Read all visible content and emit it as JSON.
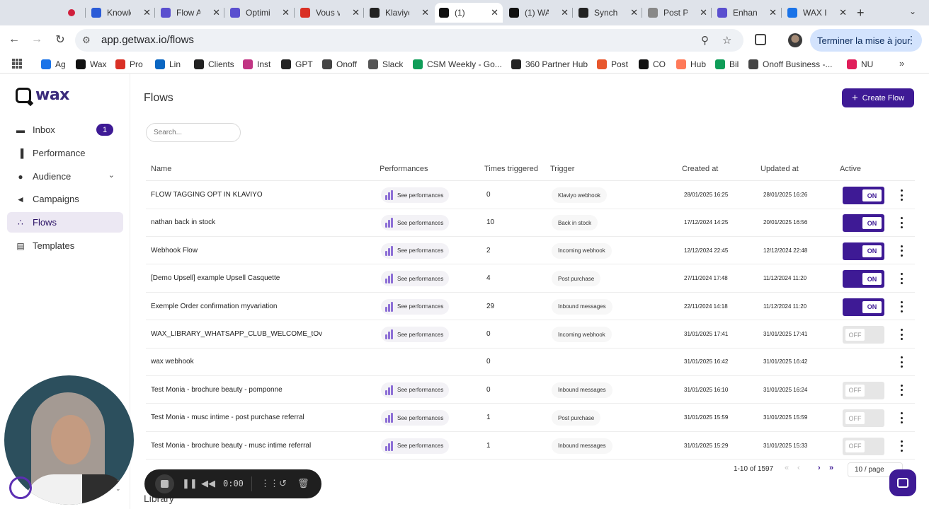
{
  "browser": {
    "tabs": [
      {
        "title": "",
        "icon": "record-icon",
        "color": "#d01f3c",
        "active": false,
        "x": 0
      },
      {
        "title": "Knowle",
        "icon": "knowledge-icon",
        "color": "#2a5bd7",
        "active": false
      },
      {
        "title": "Flow A",
        "icon": "gear-icon",
        "color": "#5a4fcf",
        "active": false
      },
      {
        "title": "Optimi",
        "icon": "gear-icon",
        "color": "#5a4fcf",
        "active": false
      },
      {
        "title": "Vous v",
        "icon": "gmail-icon",
        "color": "#d93025",
        "active": false
      },
      {
        "title": "Klaviyo",
        "icon": "klaviyo-icon",
        "color": "#222222",
        "active": false
      },
      {
        "title": "(1)",
        "icon": "wax-icon",
        "color": "#111111",
        "active": true
      },
      {
        "title": "(1) WA",
        "icon": "wax-icon",
        "color": "#111111",
        "active": false
      },
      {
        "title": "Synch",
        "icon": "openai-icon",
        "color": "#222222",
        "active": false
      },
      {
        "title": "Post P",
        "icon": "doc-icon",
        "color": "#888888",
        "active": false
      },
      {
        "title": "Enhan",
        "icon": "gear-icon",
        "color": "#5a4fcf",
        "active": false
      },
      {
        "title": "WAX I",
        "icon": "calendar-icon",
        "color": "#1a73e8",
        "active": false
      }
    ],
    "url": "app.getwax.io/flows",
    "update_label": "Terminer la mise à jour",
    "bookmarks": [
      {
        "label": "Ag",
        "icon": "calendar-icon",
        "color": "#1a73e8"
      },
      {
        "label": "Wax",
        "icon": "wax-icon",
        "color": "#111111"
      },
      {
        "label": "Pro",
        "icon": "gmail-icon",
        "color": "#d93025"
      },
      {
        "label": "Lin",
        "icon": "linkedin-icon",
        "color": "#0a66c2"
      },
      {
        "label": "Clients",
        "icon": "notion-icon",
        "color": "#222222"
      },
      {
        "label": "Inst",
        "icon": "instagram-icon",
        "color": "#c13584"
      },
      {
        "label": "GPT",
        "icon": "openai-icon",
        "color": "#222222"
      },
      {
        "label": "Onoff",
        "icon": "onoff-icon",
        "color": "#444444"
      },
      {
        "label": "Slack",
        "icon": "slack-icon",
        "color": "#555555"
      },
      {
        "label": "CSM Weekly - Go...",
        "icon": "sheets-icon",
        "color": "#0f9d58"
      },
      {
        "label": "360 Partner Hub",
        "icon": "partner-icon",
        "color": "#222222"
      },
      {
        "label": "Post",
        "icon": "post-icon",
        "color": "#e8572d"
      },
      {
        "label": "CO",
        "icon": "wax-icon",
        "color": "#111111"
      },
      {
        "label": "Hub",
        "icon": "hubspot-icon",
        "color": "#ff7a59"
      },
      {
        "label": "Bil",
        "icon": "sheets-icon",
        "color": "#0f9d58"
      },
      {
        "label": "Onoff Business -...",
        "icon": "onoff-icon",
        "color": "#444444"
      },
      {
        "label": "NU",
        "icon": "slack-icon",
        "color": "#e01e5a"
      }
    ]
  },
  "sidebar": {
    "logo_text": "wax",
    "items": [
      {
        "label": "Inbox",
        "icon": "inbox-icon",
        "badge": "1"
      },
      {
        "label": "Performance",
        "icon": "bar-chart-icon"
      },
      {
        "label": "Audience",
        "icon": "users-icon"
      },
      {
        "label": "Campaigns",
        "icon": "megaphone-icon"
      },
      {
        "label": "Flows",
        "icon": "flow-icon",
        "active": true
      },
      {
        "label": "Templates",
        "icon": "template-icon"
      }
    ]
  },
  "main": {
    "title": "Flows",
    "create_label": "Create Flow",
    "search_placeholder": "Search...",
    "columns": [
      "Name",
      "Performances",
      "Times triggered",
      "Trigger",
      "Created at",
      "Updated at",
      "Active"
    ],
    "see_performances": "See performances",
    "rows": [
      {
        "name": "FLOW TAGGING OPT IN KLAVIYO",
        "perf": true,
        "times": "0",
        "trigger": "Klaviyo webhook",
        "created": "28/01/2025 16:25",
        "updated": "28/01/2025 16:26",
        "active": "ON"
      },
      {
        "name": "nathan back in stock",
        "perf": true,
        "times": "10",
        "trigger": "Back in stock",
        "created": "17/12/2024 14:25",
        "updated": "20/01/2025 16:56",
        "active": "ON"
      },
      {
        "name": "Webhook Flow",
        "perf": true,
        "times": "2",
        "trigger": "Incoming webhook",
        "created": "12/12/2024 22:45",
        "updated": "12/12/2024 22:48",
        "active": "ON"
      },
      {
        "name": "[Demo Upsell] example Upsell Casquette",
        "perf": true,
        "times": "4",
        "trigger": "Post purchase",
        "created": "27/11/2024 17:48",
        "updated": "11/12/2024 11:20",
        "active": "ON"
      },
      {
        "name": "Exemple Order confirmation myvariation",
        "perf": true,
        "times": "29",
        "trigger": "Inbound messages",
        "created": "22/11/2024 14:18",
        "updated": "11/12/2024 11:20",
        "active": "ON"
      },
      {
        "name": "WAX_LIBRARY_WHATSAPP_CLUB_WELCOME_tOv",
        "perf": true,
        "times": "0",
        "trigger": "Incoming webhook",
        "created": "31/01/2025 17:41",
        "updated": "31/01/2025 17:41",
        "active": "OFF"
      },
      {
        "name": "wax webhook",
        "perf": false,
        "times": "0",
        "trigger": "",
        "created": "31/01/2025 16:42",
        "updated": "31/01/2025 16:42",
        "active": ""
      },
      {
        "name": "Test Monia - brochure beauty - pomponne",
        "perf": true,
        "times": "0",
        "trigger": "Inbound messages",
        "created": "31/01/2025 16:10",
        "updated": "31/01/2025 16:24",
        "active": "OFF"
      },
      {
        "name": "Test Monia - musc intime - post purchase referral",
        "perf": true,
        "times": "1",
        "trigger": "Post purchase",
        "created": "31/01/2025 15:59",
        "updated": "31/01/2025 15:59",
        "active": "OFF"
      },
      {
        "name": "Test Monia - brochure beauty - musc intime referral",
        "perf": true,
        "times": "1",
        "trigger": "Inbound messages",
        "created": "31/01/2025 15:29",
        "updated": "31/01/2025 15:33",
        "active": "OFF"
      }
    ],
    "pagination": {
      "range": "1-10 of 1597",
      "page_size": "10 / page"
    },
    "next_section": "Library"
  },
  "recorder": {
    "time": "0:00"
  },
  "colors": {
    "brand": "#3e1a95",
    "active_bg": "#ece8f3",
    "perf_bars": "#8d6fd6"
  }
}
